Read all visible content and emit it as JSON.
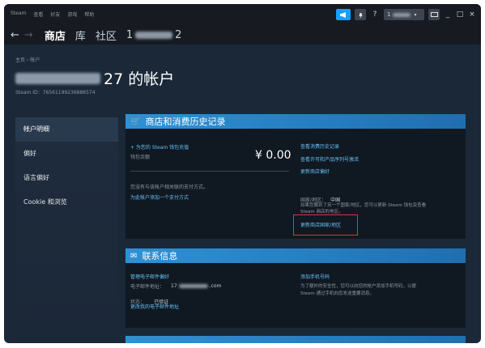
{
  "titlebar": {
    "menu": [
      "Steam",
      "查看",
      "好友",
      "游戏",
      "帮助"
    ],
    "help": "?",
    "username_suffix": "1",
    "window_controls": [
      "_",
      "□",
      "×"
    ]
  },
  "nav": {
    "back": "←",
    "forward": "→",
    "tabs": [
      "商店",
      "库",
      "社区"
    ],
    "user_prefix": "1",
    "user_suffix": "2"
  },
  "header": {
    "breadcrumb": "主页 › 帐户",
    "title_suffix": "27 的帐户",
    "steam_id": "Steam ID：76561199236886574"
  },
  "sidebar": {
    "items": [
      {
        "label": "帐户明细",
        "active": true
      },
      {
        "label": "偏好",
        "active": false
      },
      {
        "label": "语言偏好",
        "active": false
      },
      {
        "label": "Cookie 和浏览",
        "active": false
      }
    ]
  },
  "store_section": {
    "title": "商店和消费历史记录",
    "add_funds_link": "+ 为您的 Steam 钱包充值",
    "wallet_label": "钱包余额",
    "balance": "¥ 0.00",
    "no_payment_text": "您没有与该帐户相关联的支付方式。",
    "add_payment_link": "为此帐户添加一个支付方式",
    "purchase_history_link": "查看消费历史记录",
    "licenses_link": "查看许可和产品序列号激活",
    "store_prefs_link": "更新商店偏好",
    "country_label": "国家/地区：",
    "country_value": "中国",
    "country_note_line1": "如果您搬到了另一个国家/地区，您可以更新 Steam 钱包及查看",
    "country_note_line2": "Steam 商店的地区。",
    "update_country_link": "更新商店国家/地区"
  },
  "contact_section": {
    "title": "联系信息",
    "manage_email_link": "管理电子邮件偏好",
    "email_label": "电子邮件地址：",
    "email_prefix": "17",
    "email_suffix": ".com",
    "status_label": "状态：",
    "status_value": "已验证",
    "change_email_link": "更改我的电子邮件地址",
    "add_phone_link": "添加手机号码",
    "phone_note_line1": "为了额外的安全性，您可以向您的帐户添加手机号码，以便",
    "phone_note_line2": "Steam 通过手机向您发送重要消息。"
  },
  "colors": {
    "background": "#1b2838",
    "section_header": "#2f91d5",
    "link": "#66c0f4",
    "highlight_box": "#d33a3a"
  }
}
